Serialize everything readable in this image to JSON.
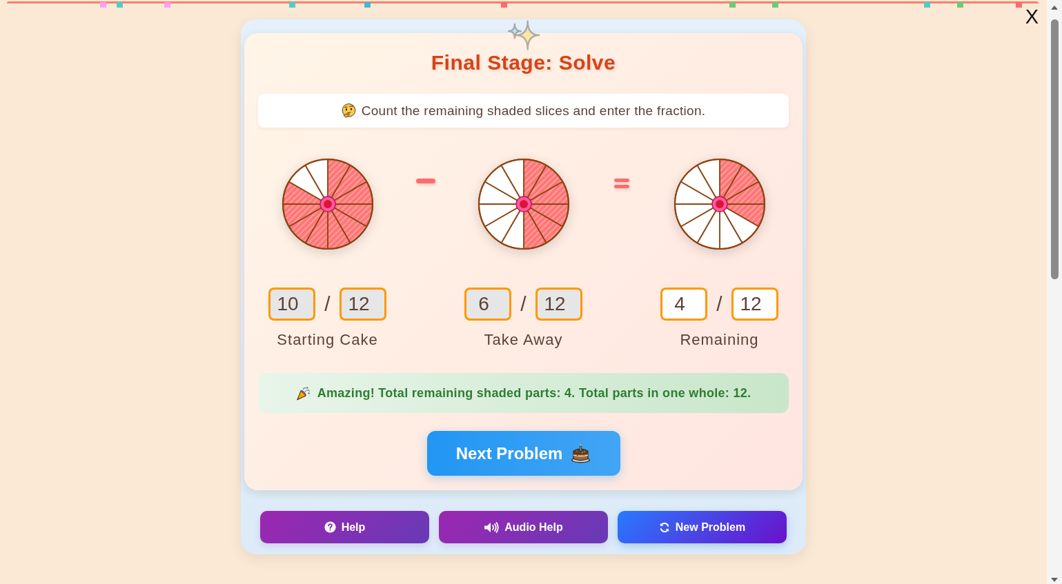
{
  "close_button": {
    "label": "X"
  },
  "card": {
    "title": "Final Stage: Solve",
    "instruction": "Count the remaining shaded slices and enter the fraction."
  },
  "groups": [
    {
      "slices": [
        {
          "shaded": true
        },
        {
          "shaded": true
        },
        {
          "shaded": true
        },
        {
          "shaded": true
        },
        {
          "shaded": true
        },
        {
          "shaded": true
        },
        {
          "shaded": true
        },
        {
          "shaded": true
        },
        {
          "shaded": true
        },
        {
          "shaded": true
        },
        {
          "shaded": false
        },
        {
          "shaded": false
        }
      ],
      "numerator": {
        "value": "10",
        "readonly": true
      },
      "separator": "/",
      "denominator": {
        "value": "12",
        "readonly": true
      },
      "label": "Starting Cake"
    },
    {
      "slices": [
        {
          "shaded": true
        },
        {
          "shaded": true
        },
        {
          "shaded": true
        },
        {
          "shaded": true
        },
        {
          "shaded": true
        },
        {
          "shaded": true
        },
        {
          "shaded": false
        },
        {
          "shaded": false
        },
        {
          "shaded": false
        },
        {
          "shaded": false
        },
        {
          "shaded": false
        },
        {
          "shaded": false
        }
      ],
      "numerator": {
        "value": "6",
        "readonly": true
      },
      "separator": "/",
      "denominator": {
        "value": "12",
        "readonly": true
      },
      "label": "Take Away"
    },
    {
      "slices": [
        {
          "shaded": true
        },
        {
          "shaded": true
        },
        {
          "shaded": true
        },
        {
          "shaded": true
        },
        {
          "shaded": false
        },
        {
          "shaded": false
        },
        {
          "shaded": false
        },
        {
          "shaded": false
        },
        {
          "shaded": false
        },
        {
          "shaded": false
        },
        {
          "shaded": false
        },
        {
          "shaded": false
        }
      ],
      "numerator": {
        "value": "4",
        "readonly": false
      },
      "separator": "/",
      "denominator": {
        "value": "12",
        "readonly": false
      },
      "label": "Remaining"
    }
  ],
  "operators": [
    {
      "kind": "minus"
    },
    {
      "kind": "equals"
    }
  ],
  "feedback": {
    "kind": "success",
    "text": "Amazing! Total remaining shaded parts: 4. Total parts in one whole: 12."
  },
  "next_button": {
    "label": "Next Problem"
  },
  "toolbar": [
    {
      "kind": "help",
      "label": "Help"
    },
    {
      "kind": "audio",
      "label": "Audio Help"
    },
    {
      "kind": "new",
      "label": "New Problem"
    }
  ]
}
